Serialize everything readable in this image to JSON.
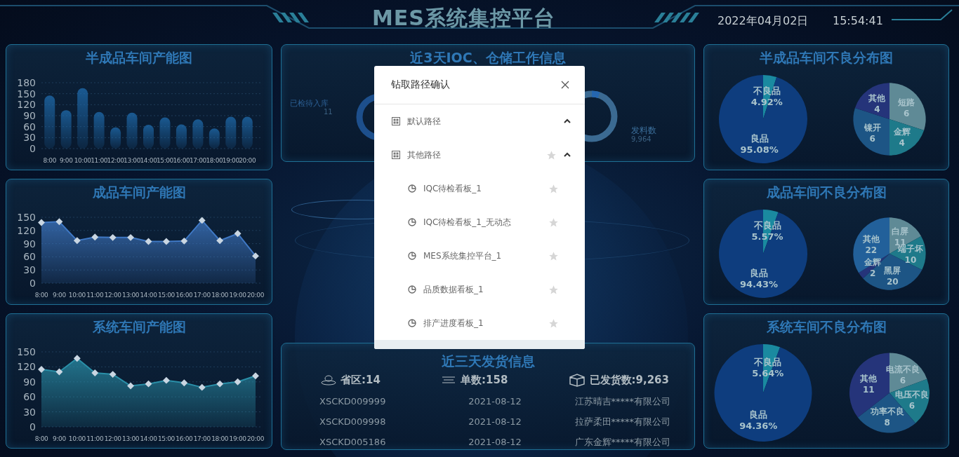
{
  "header": {
    "title": "MES系统集控平台",
    "date": "2022年04月02日",
    "time": "15:54:41"
  },
  "left_panels": [
    {
      "title": "半成品车间产能图",
      "chart_data": {
        "type": "bar",
        "categories": [
          "8:00",
          "9:00",
          "10:00",
          "11:00",
          "12:00",
          "13:00",
          "14:00",
          "15:00",
          "16:00",
          "17:00",
          "18:00",
          "19:00",
          "20:00"
        ],
        "series": [
          {
            "color": "#1f6db0",
            "values": [
              145,
              105,
              165,
              100,
              58,
              98,
              65,
              85,
              66,
              80,
              55,
              87,
              87
            ]
          }
        ],
        "grid": true,
        "ylim": [
          0,
          180
        ],
        "yticks": [
          0,
          30,
          60,
          90,
          120,
          150,
          180
        ]
      }
    },
    {
      "title": "成品车间产能图",
      "chart_data": {
        "type": "area",
        "categories": [
          "8:00",
          "9:00",
          "10:00",
          "11:00",
          "12:00",
          "13:00",
          "14:00",
          "15:00",
          "16:00",
          "17:00",
          "18:00",
          "19:00",
          "20:00"
        ],
        "series": [
          {
            "color": "#3f78c4",
            "values": [
              138,
              140,
              97,
              105,
              104,
              104,
              95,
              95,
              96,
              143,
              97,
              113,
              62
            ]
          }
        ],
        "grid": true,
        "ylim": [
          0,
          150
        ],
        "yticks": [
          0,
          30,
          60,
          90,
          120,
          150
        ]
      }
    },
    {
      "title": "系统车间产能图",
      "chart_data": {
        "type": "area",
        "categories": [
          "8:00",
          "9:00",
          "10:00",
          "11:00",
          "12:00",
          "13:00",
          "14:00",
          "15:00",
          "16:00",
          "17:00",
          "18:00",
          "19:00",
          "20:00"
        ],
        "series": [
          {
            "color": "#2a8fa8",
            "values": [
              115,
              110,
              137,
              108,
              105,
              82,
              86,
              93,
              88,
              79,
              86,
              90,
              102
            ]
          }
        ],
        "grid": true,
        "ylim": [
          0,
          150
        ],
        "yticks": [
          0,
          30,
          60,
          90,
          120,
          150
        ]
      }
    }
  ],
  "center_top": {
    "title": "近3天IOC、仓储工作信息",
    "donuts": [
      {
        "label": "已检待入库",
        "value": "11"
      },
      {
        "label": "发料数",
        "value": "9,964"
      }
    ]
  },
  "center_bottom": {
    "title": "近三天发货信息",
    "stats": [
      {
        "label": "省区:",
        "value": "14"
      },
      {
        "label": "单数:",
        "value": "158"
      },
      {
        "label": "已发货数:",
        "value": "9,263"
      }
    ],
    "rows": [
      [
        "XSCKD009999",
        "2021-08-12",
        "江苏晴吉*****有限公司"
      ],
      [
        "XSCKD009998",
        "2021-08-12",
        "拉萨柔田*****有限公司"
      ],
      [
        "XSCKD005186",
        "2021-08-12",
        "广东金辉*****有限公司"
      ]
    ]
  },
  "right_panels": [
    {
      "title": "半成品车间不良分布图",
      "pies": [
        {
          "chart_data": {
            "type": "pie",
            "categories": [
              "不良品",
              "良品"
            ],
            "values": [
              4.92,
              95.08
            ],
            "value_labels": [
              "4.92%",
              "95.08%"
            ],
            "colors": [
              "#1a8aa0",
              "#0e3d7e"
            ]
          }
        },
        {
          "chart_data": {
            "type": "pie",
            "categories": [
              "短路",
              "金辉",
              "镍开",
              "其他"
            ],
            "values": [
              6,
              4,
              6,
              4
            ],
            "value_labels": [
              "6",
              "4",
              "6",
              "4"
            ],
            "colors": [
              "#5f8a96",
              "#1e7a8a",
              "#1d5585",
              "#25347a"
            ]
          }
        }
      ]
    },
    {
      "title": "成品车间不良分布图",
      "pies": [
        {
          "chart_data": {
            "type": "pie",
            "categories": [
              "不良品",
              "良品"
            ],
            "values": [
              5.57,
              94.43
            ],
            "value_labels": [
              "5.57%",
              "94.43%"
            ],
            "colors": [
              "#1a8aa0",
              "#0e3d7e"
            ]
          }
        },
        {
          "chart_data": {
            "type": "pie",
            "categories": [
              "白屏",
              "端子坏",
              "黑屏",
              "金辉",
              "其他"
            ],
            "values": [
              11,
              10,
              20,
              2,
              22
            ],
            "value_labels": [
              "11",
              "10",
              "20",
              "2",
              "22"
            ],
            "colors": [
              "#5f8a96",
              "#1e7a8a",
              "#1d5585",
              "#25347a",
              "#22609a"
            ]
          }
        }
      ]
    },
    {
      "title": "系统车间不良分布图",
      "pies": [
        {
          "chart_data": {
            "type": "pie",
            "categories": [
              "不良品",
              "良品"
            ],
            "values": [
              5.64,
              94.36
            ],
            "value_labels": [
              "5.64%",
              "94.36%"
            ],
            "colors": [
              "#1a8aa0",
              "#0e3d7e"
            ]
          }
        },
        {
          "chart_data": {
            "type": "pie",
            "categories": [
              "电流不良",
              "电压不良",
              "功率不良",
              "其他"
            ],
            "values": [
              6,
              6,
              8,
              11
            ],
            "value_labels": [
              "6",
              "6",
              "8",
              "11"
            ],
            "colors": [
              "#5f8a96",
              "#1e7a8a",
              "#1d5585",
              "#25347a"
            ]
          }
        }
      ]
    }
  ],
  "modal": {
    "title": "钻取路径确认",
    "tree": [
      {
        "label": "默认路径",
        "expanded": true
      },
      {
        "label": "其他路径",
        "expanded": true,
        "starred": false,
        "children": [
          {
            "label": "IQC待检看板_1",
            "starred": false
          },
          {
            "label": "IQC待检看板_1_无动态",
            "starred": false
          },
          {
            "label": "MES系统集控平台_1",
            "starred": false
          },
          {
            "label": "品质数据看板_1",
            "starred": false
          },
          {
            "label": "排产进度看板_1",
            "starred": false
          }
        ]
      }
    ]
  }
}
